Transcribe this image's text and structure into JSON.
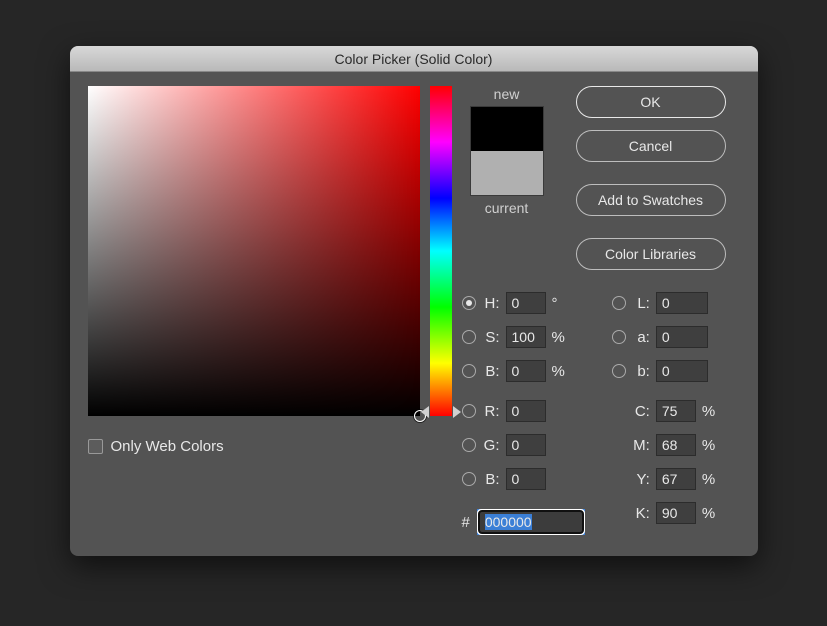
{
  "title": "Color Picker (Solid Color)",
  "swatch": {
    "new_label": "new",
    "current_label": "current"
  },
  "buttons": {
    "ok": "OK",
    "cancel": "Cancel",
    "add": "Add to Swatches",
    "libraries": "Color Libraries"
  },
  "hsb": {
    "h_label": "H:",
    "h_val": "0",
    "h_unit": "°",
    "s_label": "S:",
    "s_val": "100",
    "s_unit": "%",
    "b_label": "B:",
    "b_val": "0",
    "b_unit": "%",
    "selected": "h"
  },
  "lab": {
    "l_label": "L:",
    "l_val": "0",
    "a_label": "a:",
    "a_val": "0",
    "b_label": "b:",
    "b_val": "0"
  },
  "rgb": {
    "r_label": "R:",
    "r_val": "0",
    "g_label": "G:",
    "g_val": "0",
    "b_label": "B:",
    "b_val": "0"
  },
  "cmyk": {
    "c_label": "C:",
    "c_val": "75",
    "m_label": "M:",
    "m_val": "68",
    "y_label": "Y:",
    "y_val": "67",
    "k_label": "K:",
    "k_val": "90",
    "unit": "%"
  },
  "hex": {
    "label": "#",
    "val": "000000"
  },
  "webcolors": {
    "label": "Only Web Colors",
    "checked": false
  },
  "colors": {
    "new": "#000000",
    "current": "#b0b0b0",
    "hue": "#ff0000"
  }
}
